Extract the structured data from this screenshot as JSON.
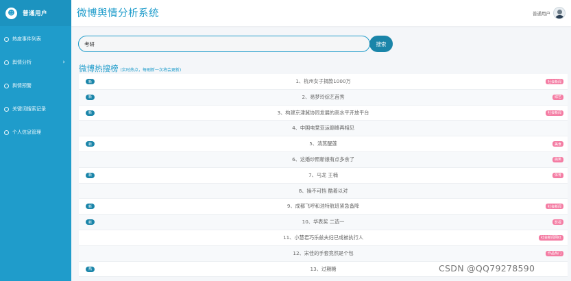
{
  "brand": {
    "icon": "smiley-icon",
    "name": "普通用户"
  },
  "sidebar": {
    "items": [
      {
        "label": "热度事件列表",
        "icon": "circle-icon",
        "has_submenu": false
      },
      {
        "label": "舆情分析",
        "icon": "circle-icon",
        "has_submenu": true,
        "arrow": "›"
      },
      {
        "label": "舆情预警",
        "icon": "circle-icon",
        "has_submenu": false
      },
      {
        "label": "关键词搜索记录",
        "icon": "circle-icon",
        "has_submenu": false
      },
      {
        "label": "个人信息管理",
        "icon": "circle-icon",
        "has_submenu": false
      }
    ]
  },
  "header": {
    "title": "微博舆情分析系统",
    "user_label": "普通用户",
    "avatar_icon": "user-avatar-icon"
  },
  "search": {
    "value": "考研",
    "button_label": "搜索"
  },
  "section": {
    "title": "微博热搜榜",
    "subtitle": "(实时热点，每刷新一次将会更新)"
  },
  "hot_list": [
    {
      "text": "1、杭州女子捐款1000万",
      "badge": "新",
      "tag": "社会新闻"
    },
    {
      "text": "2、易梦玲综艺首秀",
      "badge": "新",
      "tag": "综艺"
    },
    {
      "text": "3、构建京津冀协同发展的高水平开放平台",
      "badge": "新",
      "tag": "社会新闻"
    },
    {
      "text": "4、中国电竞亚运巅峰再相见",
      "badge": "",
      "tag": ""
    },
    {
      "text": "5、清蒸醒莲",
      "badge": "新",
      "tag": "美食"
    },
    {
      "text": "6、这婚纱照新娘有点多余了",
      "badge": "",
      "tag": "搞笑"
    },
    {
      "text": "7、马龙 王楠",
      "badge": "新",
      "tag": "体育"
    },
    {
      "text": "8、操不可挡 酷着以对",
      "badge": "",
      "tag": ""
    },
    {
      "text": "9、成都飞呼和浩特航班紧急备降",
      "badge": "新",
      "tag": "社会新闻"
    },
    {
      "text": "10、华表奖 二选一",
      "badge": "新",
      "tag": "影视"
    },
    {
      "text": "11、小慧君巧乐兹夫妇已成被执行人",
      "badge": "",
      "tag": "社会新闻网红"
    },
    {
      "text": "12、宋佳的手套竟然是个包",
      "badge": "",
      "tag": "作品热门"
    },
    {
      "text": "13、过期糖",
      "badge": "热",
      "tag": ""
    }
  ],
  "watermark": "CSDN @QQ79278590",
  "colors": {
    "primary": "#1f9ccb",
    "button": "#1a85a9",
    "tag": "#f47ca3"
  }
}
